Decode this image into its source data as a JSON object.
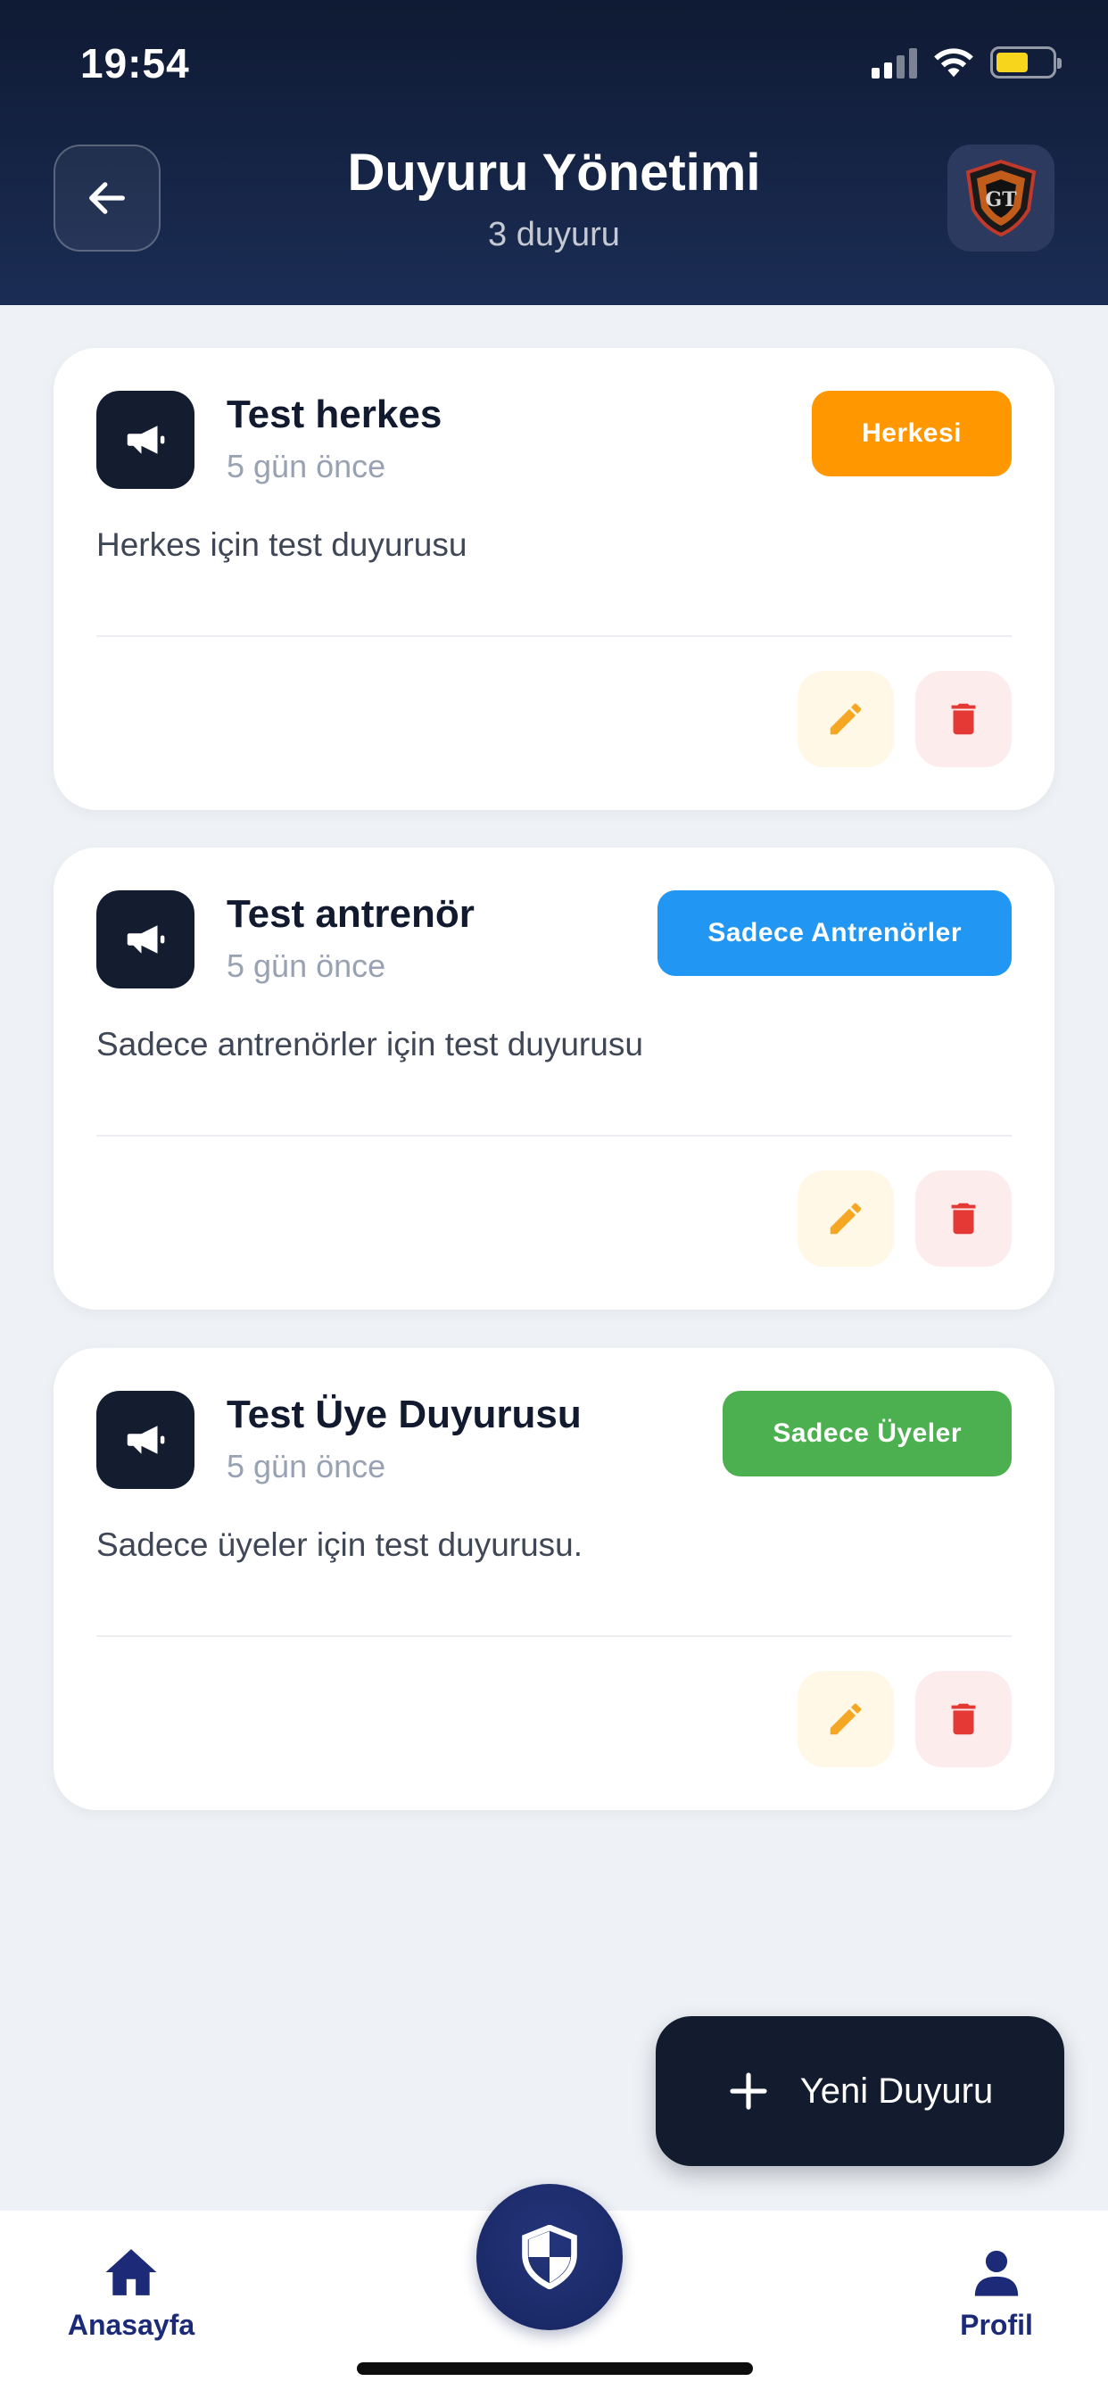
{
  "status_bar": {
    "time": "19:54",
    "battery_level": 0.58
  },
  "header": {
    "title": "Duyuru Yönetimi",
    "subtitle": "3 duyuru",
    "back_icon": "arrow-left-icon",
    "logo_text": "GT"
  },
  "announcements": [
    {
      "title": "Test herkes",
      "time": "5 gün önce",
      "body": "Herkes için test duyurusu",
      "audience": "Herkesi",
      "audience_color": "#ff9800"
    },
    {
      "title": "Test antrenör",
      "time": "5 gün önce",
      "body": "Sadece antrenörler için test duyurusu",
      "audience": "Sadece Antrenörler",
      "audience_color": "#2196f3"
    },
    {
      "title": "Test Üye Duyurusu",
      "time": "5 gün önce",
      "body": "Sadece üyeler için test duyurusu.",
      "audience": "Sadece Üyeler",
      "audience_color": "#4caf50"
    }
  ],
  "fab": {
    "label": "Yeni Duyuru",
    "icon": "plus-icon"
  },
  "bottom_nav": {
    "home": {
      "label": "Anasayfa",
      "icon": "home-icon"
    },
    "center": {
      "icon": "shield-icon"
    },
    "profile": {
      "label": "Profil",
      "icon": "user-icon"
    }
  },
  "colors": {
    "header_dark": "#0f1a33",
    "edit": "#f5a623",
    "delete": "#e53935",
    "nav_blue": "#1c2a78"
  }
}
